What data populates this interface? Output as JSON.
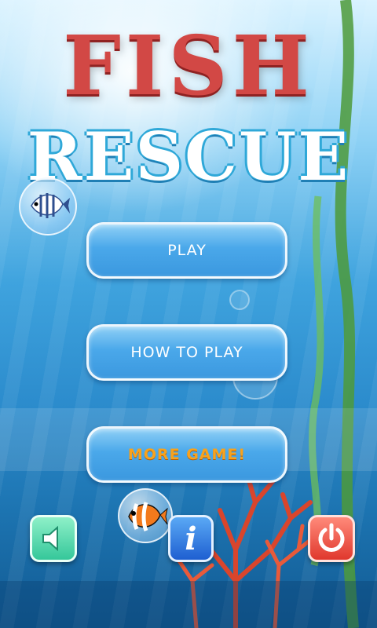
{
  "title": {
    "line1": "FISH",
    "line2": "RESCUE"
  },
  "menu": {
    "play": "PLAY",
    "how_to_play": "HOW TO PLAY",
    "more_games": "MORE GAME!"
  },
  "controls": {
    "sound_icon": "speaker-icon",
    "info_icon": "info-icon",
    "power_icon": "power-icon",
    "info_glyph": "i"
  },
  "colors": {
    "title_red": "#d24845",
    "button_blue": "#4aa8ea",
    "more_orange": "#f7a21d",
    "sound_green": "#35c79a",
    "info_blue": "#1e5fd1",
    "power_red": "#e0382d"
  }
}
